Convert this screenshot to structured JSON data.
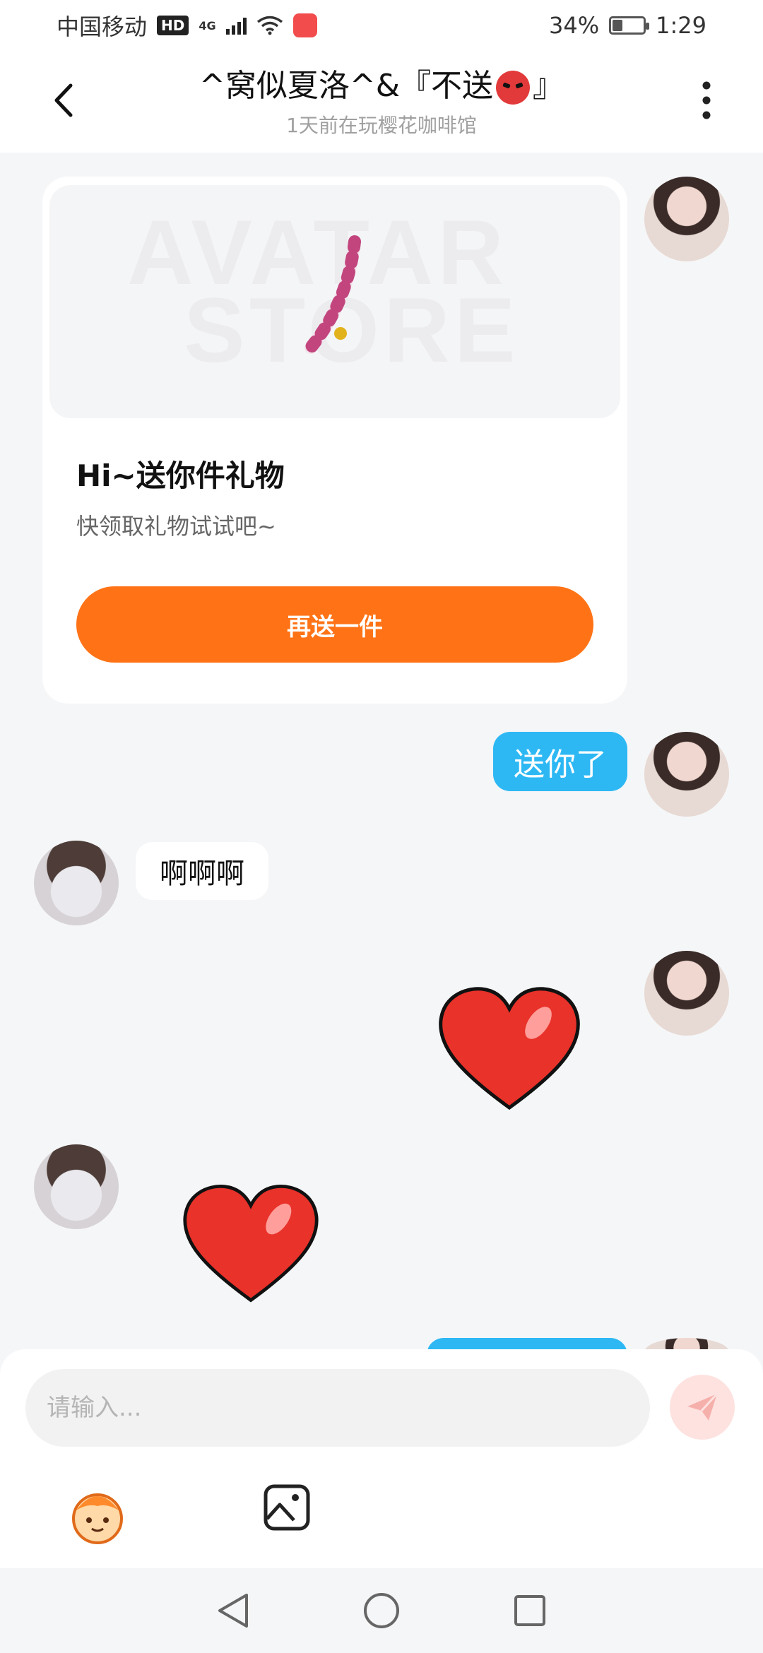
{
  "status_bar": {
    "carrier": "中国移动",
    "hd": "HD",
    "network": "4G",
    "battery": "34%",
    "battery_level": 0.34,
    "time": "1:29"
  },
  "header": {
    "title_prefix": "^窝似夏洛^&『不送",
    "title_suffix": "』",
    "subtitle": "1天前在玩樱花咖啡馆"
  },
  "gift_card": {
    "watermark_line1": "AVATAR",
    "watermark_line2": "STORE",
    "title": "Hi~送你件礼物",
    "description": "快领取礼物试试吧~",
    "button_label": "再送一件"
  },
  "messages": [
    {
      "side": "right",
      "type": "text",
      "text": "送你了"
    },
    {
      "side": "left",
      "type": "text",
      "text": "啊啊啊"
    },
    {
      "side": "right",
      "type": "sticker",
      "sticker": "red-heart"
    },
    {
      "side": "left",
      "type": "sticker",
      "sticker": "red-heart"
    }
  ],
  "composer": {
    "placeholder": "请输入...",
    "value": ""
  },
  "colors": {
    "accent_orange": "#ff7316",
    "bubble_blue": "#2db8f4",
    "background": "#f5f6f8"
  },
  "icons": [
    "back-icon",
    "more-vertical-icon",
    "send-icon",
    "emoji-icon",
    "image-icon",
    "nav-back-icon",
    "nav-home-icon",
    "nav-recent-icon"
  ]
}
